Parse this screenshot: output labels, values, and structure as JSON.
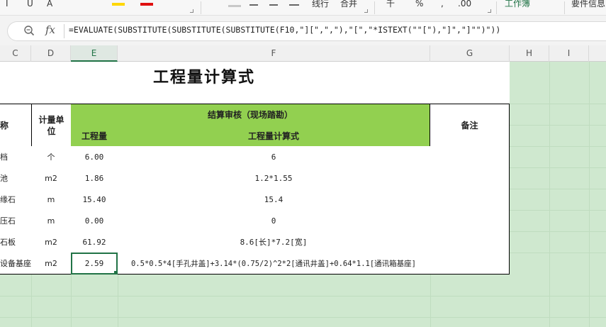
{
  "toolbar": {
    "glyphs": [
      "I",
      "U",
      "A"
    ],
    "text_fragments": [
      "线行",
      "合并",
      "千",
      "%",
      ",",
      ".00",
      "工作簿",
      "要件信息"
    ],
    "colors": {
      "highlight": "#ffd700",
      "font_color": "#e01010"
    }
  },
  "formula_bar": {
    "zoom_icon": "magnifier-icon",
    "fx_label": "fx",
    "formula": "=EVALUATE(SUBSTITUTE(SUBSTITUTE(SUBSTITUTE(F10,\"][\",\",\"),\"[\",\"*ISTEXT(\"\"[\"),\"]\",\"]\"\")\"))"
  },
  "columns": [
    "C",
    "D",
    "E",
    "F",
    "G",
    "H",
    "I"
  ],
  "selected_column": "E",
  "sheet": {
    "title": "工程量计算式",
    "headers": {
      "name_partial": "称",
      "unit": "计量单位",
      "group": "结算审核（现场踏勘）",
      "quantity": "工程量",
      "formula_col": "工程量计算式",
      "remark": "备注"
    },
    "rows": [
      {
        "name": "档",
        "unit": "个",
        "qty": "6.00",
        "formula": "6"
      },
      {
        "name": "池",
        "unit": "m2",
        "qty": "1.86",
        "formula": "1.2*1.55"
      },
      {
        "name": "缘石",
        "unit": "m",
        "qty": "15.40",
        "formula": "15.4"
      },
      {
        "name": "压石",
        "unit": "m",
        "qty": "0.00",
        "formula": "0"
      },
      {
        "name": "石板",
        "unit": "m2",
        "qty": "61.92",
        "formula": "8.6[长]*7.2[宽]"
      },
      {
        "name": "设备基座",
        "unit": "m2",
        "qty": "2.59",
        "formula": "0.5*0.5*4[手孔井盖]+3.14*(0.75/2)^2*2[通讯井盖]+0.64*1.1[通讯箱基座]"
      }
    ]
  },
  "theme": {
    "accent": "#217346",
    "header_green": "#92d050",
    "sheet_bg_green": "#cfe8cf"
  }
}
